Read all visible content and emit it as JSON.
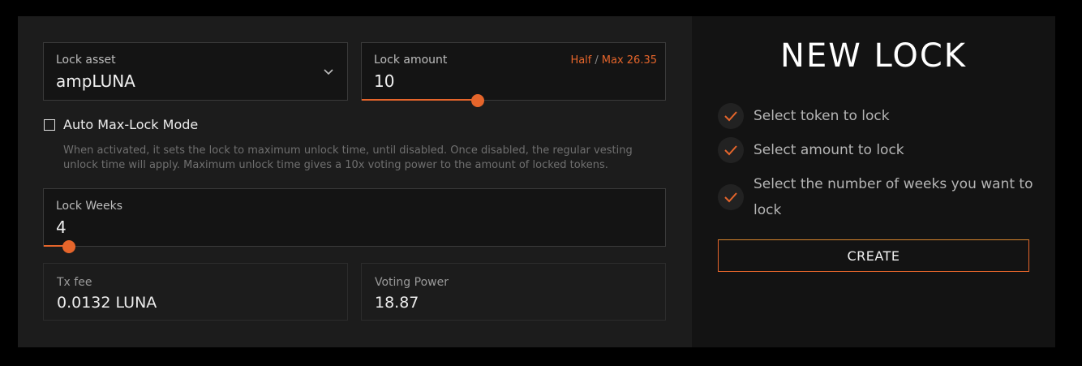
{
  "form": {
    "lock_asset": {
      "label": "Lock asset",
      "value": "ampLUNA"
    },
    "lock_amount": {
      "label": "Lock amount",
      "value": "10",
      "half_label": "Half",
      "separator": "/",
      "max_label": "Max 26.35",
      "slider_fraction": 0.38
    },
    "auto_mode": {
      "label": "Auto Max-Lock Mode",
      "checked": false,
      "help": "When activated, it sets the lock to maximum unlock time, until disabled. Once disabled, the regular vesting unlock time will apply. Maximum unlock time gives a 10x voting power to the amount of locked tokens."
    },
    "lock_weeks": {
      "label": "Lock Weeks",
      "value": "4",
      "slider_fraction": 0.04
    },
    "tx_fee": {
      "label": "Tx fee",
      "value": "0.0132 LUNA"
    },
    "voting_power": {
      "label": "Voting Power",
      "value": "18.87"
    }
  },
  "summary": {
    "title": "NEW LOCK",
    "steps": [
      {
        "text": "Select token to lock",
        "icon": "check-icon"
      },
      {
        "text": "Select amount to lock",
        "icon": "check-icon"
      },
      {
        "text": "Select the number of weeks you want to lock",
        "icon": "check-icon"
      }
    ],
    "create_label": "CREATE"
  },
  "colors": {
    "accent": "#e5652b",
    "panel": "#1c1c1c",
    "field": "#141414",
    "summary_bg": "#131313"
  }
}
